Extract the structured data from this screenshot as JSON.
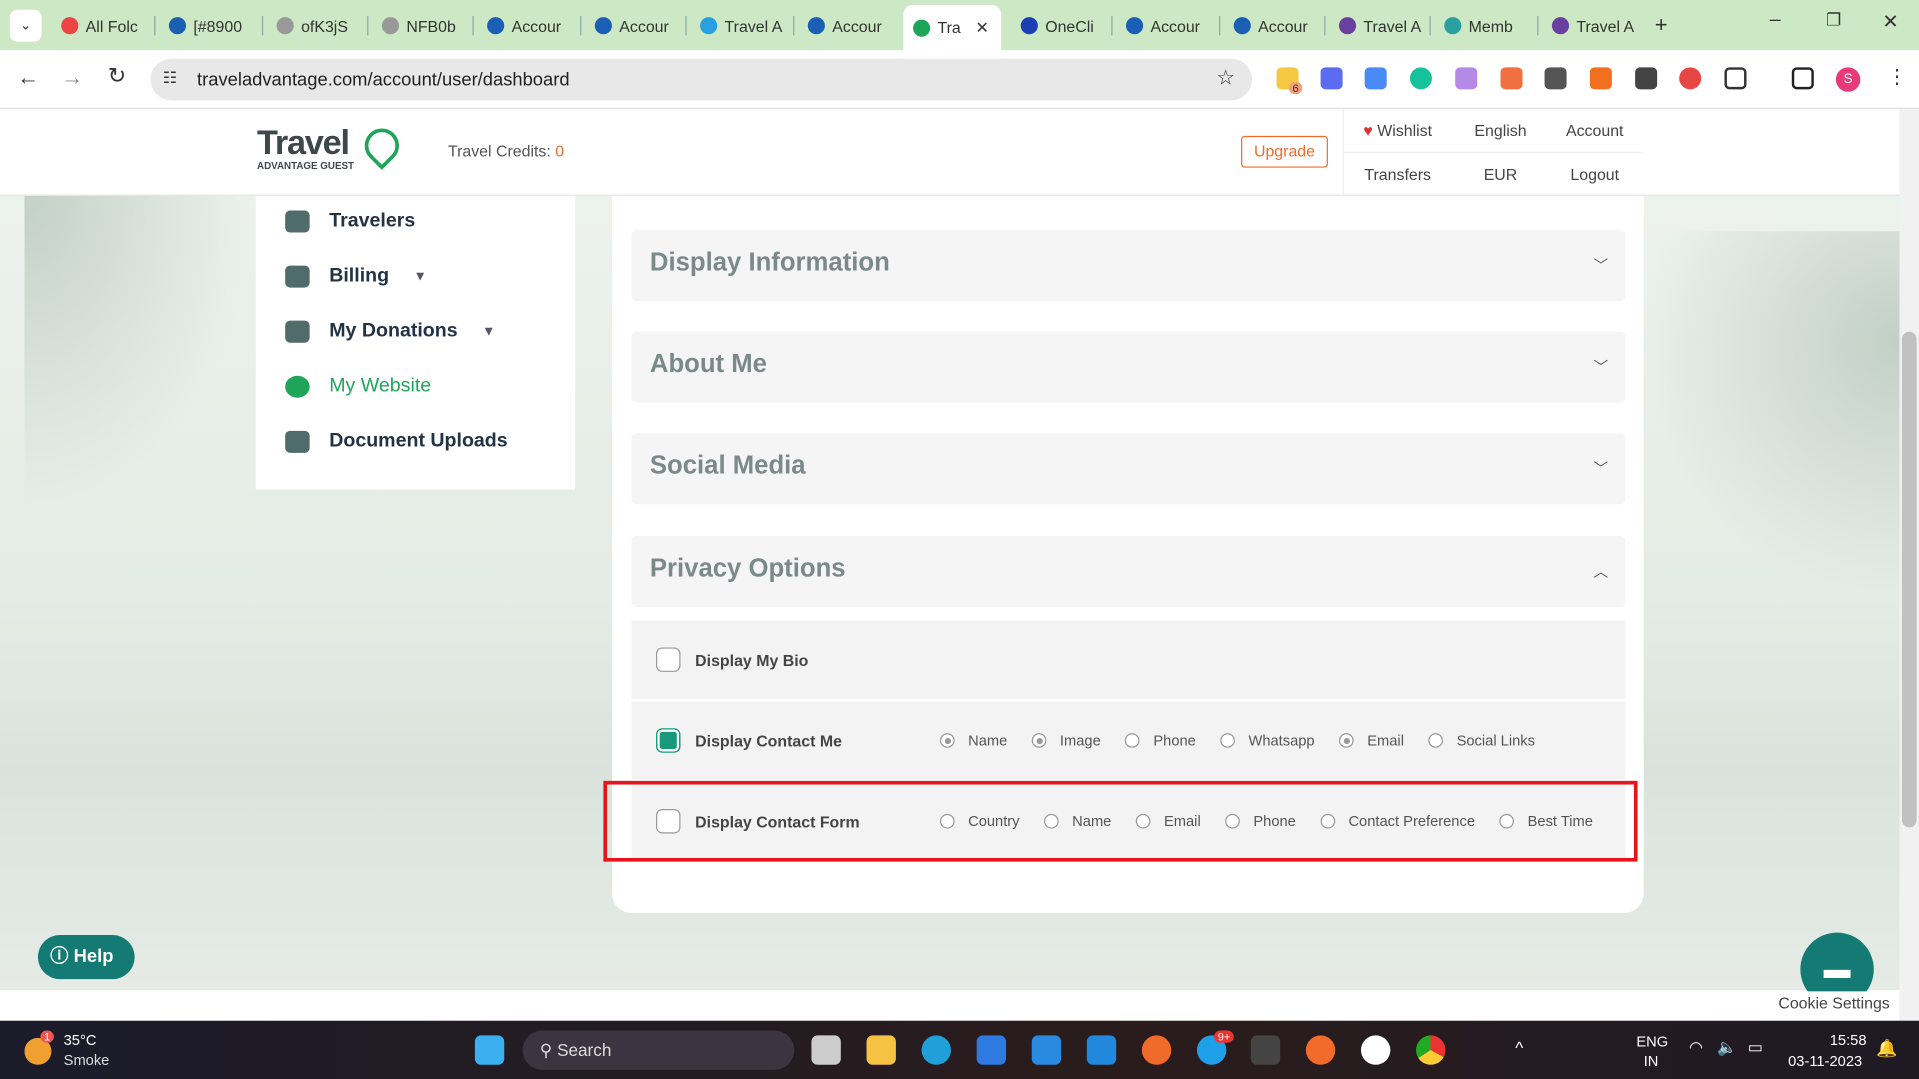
{
  "browser": {
    "tabs": [
      "All Folc",
      "[#8900",
      "ofK3jS",
      "NFB0b",
      "Accour",
      "Accour",
      "Travel A",
      "Accour",
      "Tra",
      "OneCli",
      "Accour",
      "Accour",
      "Travel A",
      "Memb",
      "Travel A"
    ],
    "active_tab_index": 8,
    "url": "traveladvantage.com/account/user/dashboard",
    "profile_initial": "S",
    "extension_badge": "6"
  },
  "header": {
    "logo_text": "Travel",
    "logo_sub": "ADVANTAGE GUEST",
    "credits_label": "Travel Credits:",
    "credits_value": "0",
    "upgrade": "Upgrade",
    "nav": {
      "wishlist": "Wishlist",
      "language": "English",
      "account": "Account",
      "transfers": "Transfers",
      "currency": "EUR",
      "logout": "Logout"
    }
  },
  "sidebar": {
    "items": [
      {
        "label": "Travelers",
        "active": false
      },
      {
        "label": "Billing",
        "active": false,
        "dropdown": true
      },
      {
        "label": "My Donations",
        "active": false,
        "dropdown": true
      },
      {
        "label": "My Website",
        "active": true
      },
      {
        "label": "Document Uploads",
        "active": false
      }
    ]
  },
  "sections": [
    {
      "title": "Display Information",
      "expanded": false
    },
    {
      "title": "About Me",
      "expanded": false
    },
    {
      "title": "Social Media",
      "expanded": false
    },
    {
      "title": "Privacy Options",
      "expanded": true
    }
  ],
  "privacy": {
    "bio": {
      "label": "Display My Bio",
      "checked": false
    },
    "contact_me": {
      "label": "Display Contact Me",
      "checked": true,
      "options": [
        {
          "label": "Name",
          "on": true
        },
        {
          "label": "Image",
          "on": true
        },
        {
          "label": "Phone",
          "on": false
        },
        {
          "label": "Whatsapp",
          "on": false
        },
        {
          "label": "Email",
          "on": true
        },
        {
          "label": "Social Links",
          "on": false
        }
      ]
    },
    "contact_form": {
      "label": "Display Contact Form",
      "checked": false,
      "options": [
        {
          "label": "Country",
          "on": false
        },
        {
          "label": "Name",
          "on": false
        },
        {
          "label": "Email",
          "on": false
        },
        {
          "label": "Phone",
          "on": false
        },
        {
          "label": "Contact Preference",
          "on": false
        },
        {
          "label": "Best Time",
          "on": false
        }
      ]
    }
  },
  "help": "Help",
  "cookie": "Cookie Settings",
  "taskbar": {
    "temp": "35°C",
    "weather": "Smoke",
    "weather_badge": "1",
    "search": "Search",
    "lang1": "ENG",
    "lang2": "IN",
    "time": "15:58",
    "date": "03-11-2023",
    "skype_badge": "9+"
  },
  "colors": {
    "accent": "#179a7c",
    "upgrade": "#f26b2a",
    "highlight": "#e8141c"
  }
}
